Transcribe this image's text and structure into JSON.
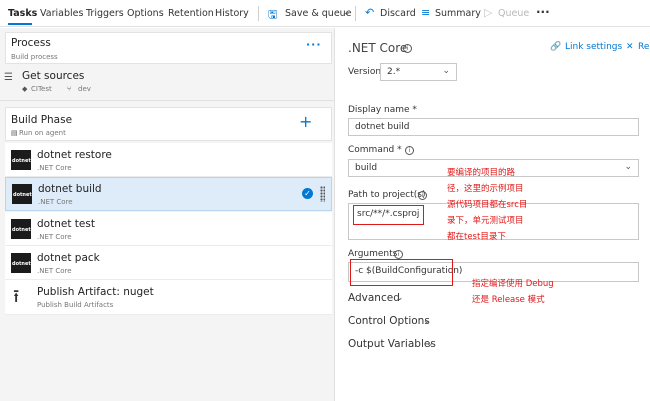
{
  "toolbar": {
    "tabs": [
      "Tasks",
      "Variables",
      "Triggers",
      "Options",
      "Retention",
      "History"
    ],
    "save_label": "Save & queue",
    "discard_label": "Discard",
    "summary_label": "Summary",
    "queue_label": "Queue",
    "more": "···"
  },
  "process": {
    "title": "Process",
    "subtitle": "Build process",
    "more": "···"
  },
  "sources": {
    "title": "Get sources",
    "repo": "CITest",
    "branch": "dev"
  },
  "phase": {
    "title": "Build Phase",
    "subtitle": "Run on agent",
    "add": "+"
  },
  "tasks": [
    {
      "icon_text": "dotnet",
      "title": "dotnet restore",
      "subtitle": ".NET Core"
    },
    {
      "icon_text": "dotnet",
      "title": "dotnet build",
      "subtitle": ".NET Core"
    },
    {
      "icon_text": "dotnet",
      "title": "dotnet test",
      "subtitle": ".NET Core"
    },
    {
      "icon_text": "dotnet",
      "title": "dotnet pack",
      "subtitle": ".NET Core"
    }
  ],
  "publish": {
    "title": "Publish Artifact: nuget",
    "subtitle": "Publish Build Artifacts"
  },
  "detail": {
    "title": ".NET Core",
    "link_settings": "Link settings",
    "remove": "Rem",
    "version_label": "Version",
    "version_value": "2.*",
    "display_name_label": "Display name *",
    "display_name_value": "dotnet build",
    "command_label": "Command *",
    "command_value": "build",
    "path_label": "Path to project(s)",
    "path_value": "src/**/*.csproj",
    "arguments_label": "Arguments",
    "arguments_value": "-c $(BuildConfiguration)",
    "sections": [
      "Advanced",
      "Control Options",
      "Output Variables"
    ]
  },
  "annotations": {
    "note1": [
      "要编译的项目的路",
      "径，这里的示例项目",
      "源代码项目都在src目",
      "录下，单元测试项目",
      "都在test目录下"
    ],
    "note2": [
      "指定编译使用 Debug",
      "还是 Release 模式"
    ]
  },
  "colors": {
    "accent": "#0078d4",
    "annotation": "#e01818",
    "selected": "#deecf9"
  }
}
